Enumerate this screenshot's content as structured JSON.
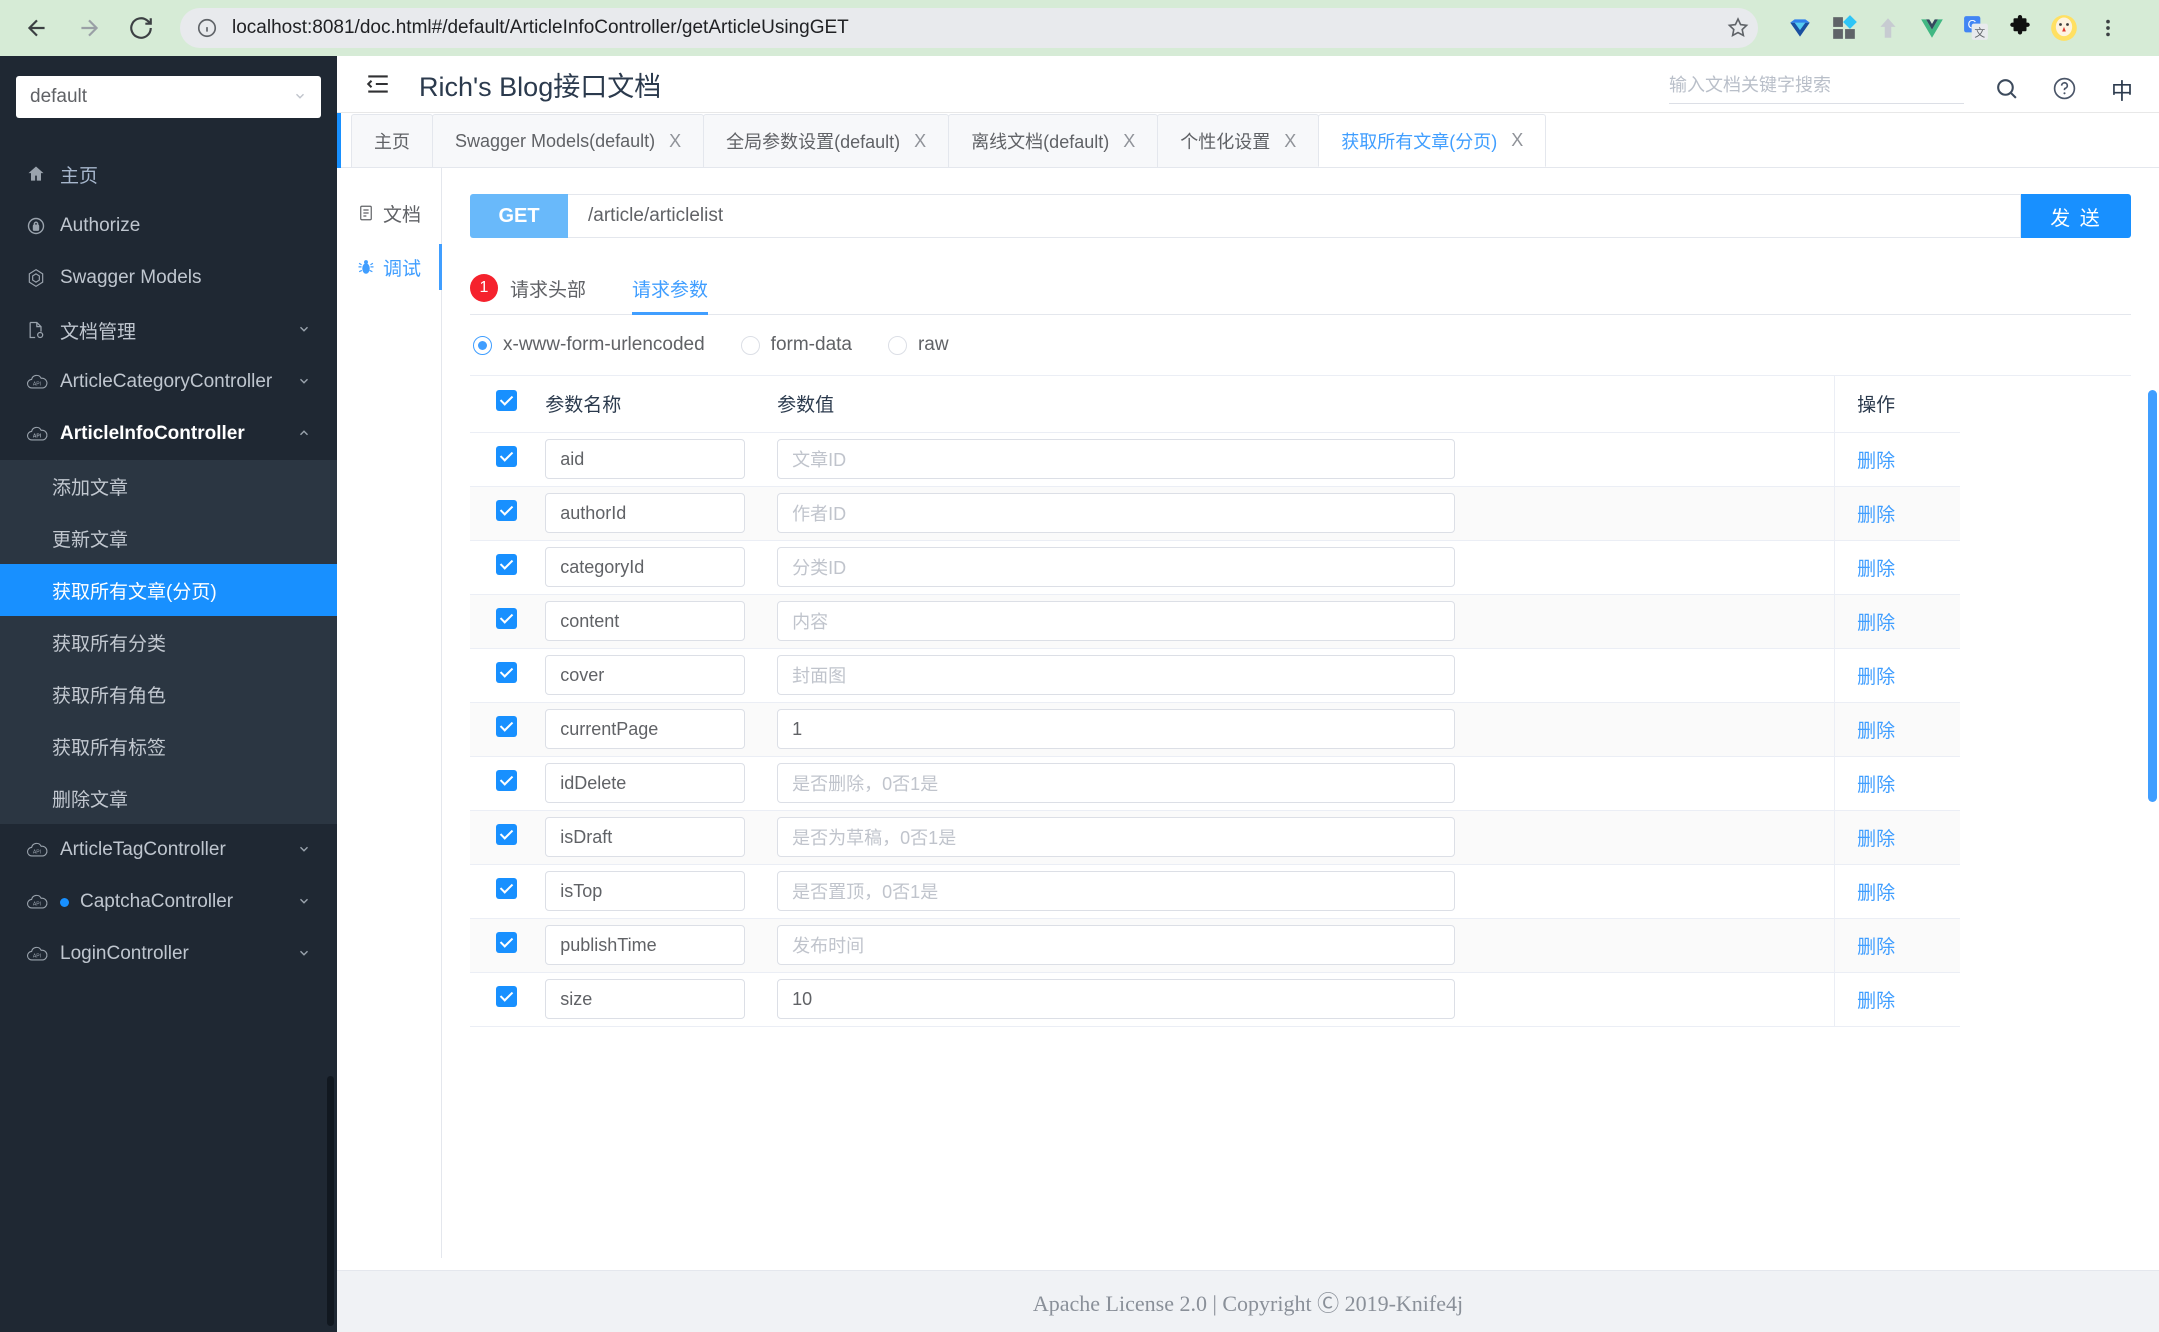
{
  "browser": {
    "url": "localhost:8081/doc.html#/default/ArticleInfoController/getArticleUsingGET",
    "back_icon": "back-arrow-icon",
    "forward_icon": "forward-arrow-icon",
    "reload_icon": "reload-icon",
    "info_icon": "info-circle-icon",
    "star_icon": "bookmark-star-icon",
    "extensions": [
      {
        "name": "diamond-extension-icon"
      },
      {
        "name": "apps-grid-extension-icon"
      },
      {
        "name": "upload-arrow-extension-icon"
      },
      {
        "name": "vue-devtools-extension-icon"
      },
      {
        "name": "google-translate-extension-icon"
      },
      {
        "name": "puzzle-extensions-icon"
      },
      {
        "name": "user-avatar-icon"
      },
      {
        "name": "chrome-menu-icon"
      }
    ]
  },
  "sidebar": {
    "service": {
      "value": "default",
      "chevron": "chevron-down-icon"
    },
    "items": [
      {
        "label": "主页",
        "icon": "home-icon",
        "type": "link"
      },
      {
        "label": "Authorize",
        "icon": "lock-icon",
        "type": "link"
      },
      {
        "label": "Swagger Models",
        "icon": "cube-icon",
        "type": "link"
      },
      {
        "label": "文档管理",
        "icon": "doc-settings-icon",
        "type": "group"
      },
      {
        "label": "ArticleCategoryController",
        "icon": "api-cloud-icon",
        "type": "group"
      },
      {
        "label": "ArticleInfoController",
        "icon": "api-cloud-icon",
        "type": "group",
        "expanded": true
      }
    ],
    "submenu": [
      {
        "label": "添加文章"
      },
      {
        "label": "更新文章"
      },
      {
        "label": "获取所有文章(分页)",
        "selected": true
      },
      {
        "label": "获取所有分类"
      },
      {
        "label": "获取所有角色"
      },
      {
        "label": "获取所有标签"
      },
      {
        "label": "删除文章"
      }
    ],
    "items_after": [
      {
        "label": "ArticleTagController",
        "icon": "api-cloud-icon",
        "type": "group"
      },
      {
        "label": "CaptchaController",
        "icon": "api-cloud-icon",
        "type": "group",
        "dot": true
      },
      {
        "label": "LoginController",
        "icon": "api-cloud-icon",
        "type": "group"
      }
    ]
  },
  "header": {
    "collapse_icon": "collapse-menu-icon",
    "title": "Rich's Blog接口文档",
    "search_placeholder": "输入文档关键字搜索",
    "search_value": "",
    "search_icon": "search-icon",
    "help_icon": "help-circle-icon",
    "lang_label": "中"
  },
  "tabs": [
    {
      "label": "主页",
      "closable": false,
      "active": false
    },
    {
      "label": "Swagger Models(default)",
      "closable": true,
      "active": false
    },
    {
      "label": "全局参数设置(default)",
      "closable": true,
      "active": false
    },
    {
      "label": "离线文档(default)",
      "closable": true,
      "active": false
    },
    {
      "label": "个性化设置",
      "closable": true,
      "active": false
    },
    {
      "label": "获取所有文章(分页)",
      "closable": true,
      "active": true
    }
  ],
  "close_label": "X",
  "side_tabs": [
    {
      "label": "文档",
      "icon": "document-icon",
      "active": false
    },
    {
      "label": "调试",
      "icon": "bug-icon",
      "active": true
    }
  ],
  "request": {
    "method": "GET",
    "path": "/article/articlelist",
    "send_label": "发 送"
  },
  "request_tabs": [
    {
      "label": "请求头部",
      "badge": "1",
      "active": false
    },
    {
      "label": "请求参数",
      "badge": "",
      "active": true
    }
  ],
  "body_types": [
    {
      "label": "x-www-form-urlencoded",
      "selected": true
    },
    {
      "label": "form-data",
      "selected": false
    },
    {
      "label": "raw",
      "selected": false
    }
  ],
  "table": {
    "headers": {
      "check": "",
      "name": "参数名称",
      "value": "参数值",
      "op": "操作"
    },
    "delete_label": "删除",
    "rows": [
      {
        "checked": true,
        "name": "aid",
        "value": "",
        "placeholder": "文章ID"
      },
      {
        "checked": true,
        "name": "authorId",
        "value": "",
        "placeholder": "作者ID"
      },
      {
        "checked": true,
        "name": "categoryId",
        "value": "",
        "placeholder": "分类ID"
      },
      {
        "checked": true,
        "name": "content",
        "value": "",
        "placeholder": "内容"
      },
      {
        "checked": true,
        "name": "cover",
        "value": "",
        "placeholder": "封面图"
      },
      {
        "checked": true,
        "name": "currentPage",
        "value": "1",
        "placeholder": ""
      },
      {
        "checked": true,
        "name": "idDelete",
        "value": "",
        "placeholder": "是否删除，0否1是"
      },
      {
        "checked": true,
        "name": "isDraft",
        "value": "",
        "placeholder": "是否为草稿，0否1是"
      },
      {
        "checked": true,
        "name": "isTop",
        "value": "",
        "placeholder": "是否置顶，0否1是"
      },
      {
        "checked": true,
        "name": "publishTime",
        "value": "",
        "placeholder": "发布时间"
      },
      {
        "checked": true,
        "name": "size",
        "value": "10",
        "placeholder": ""
      }
    ]
  },
  "footer": {
    "text": "Apache License 2.0 | Copyright Ⓒ 2019-Knife4j"
  },
  "colors": {
    "accent": "#1890ff",
    "sidebar_bg": "#1f2833",
    "submenu_bg": "#2b3642",
    "method_badge": "#69b9fa",
    "badge_red": "#f5222d"
  }
}
